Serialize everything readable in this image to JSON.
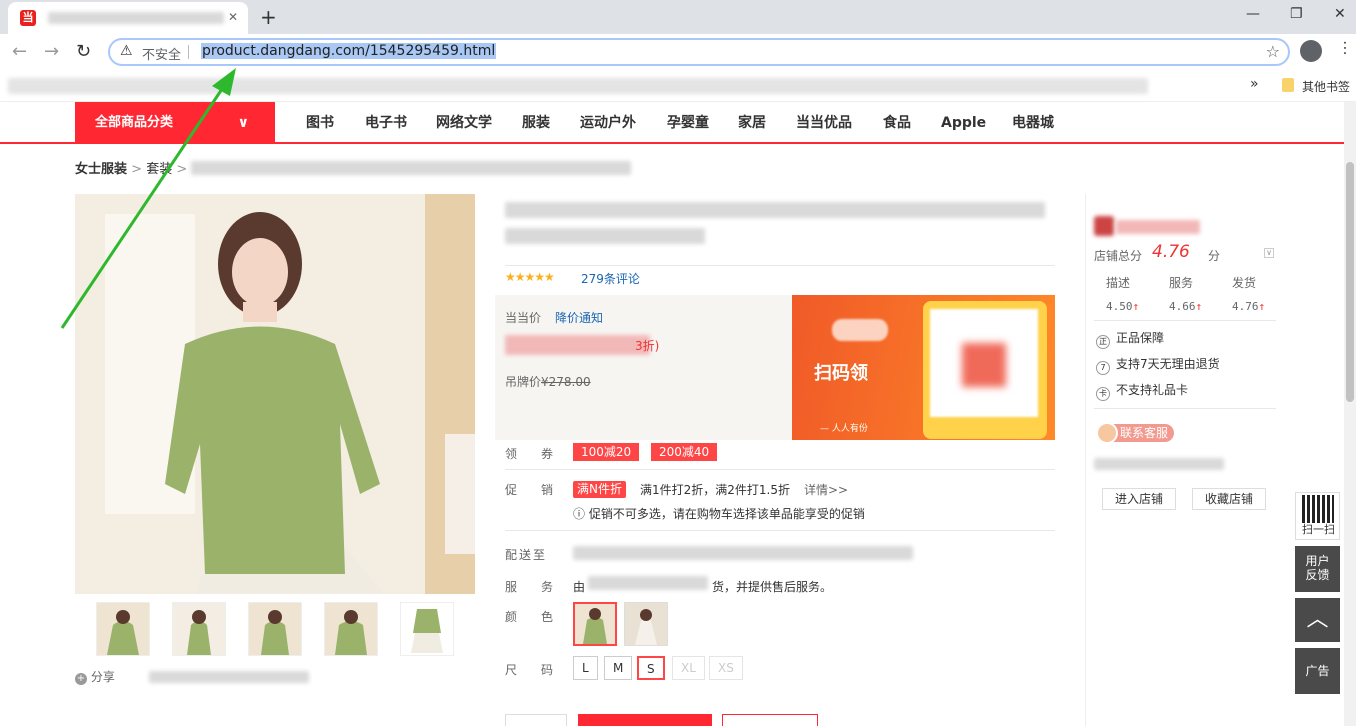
{
  "browser": {
    "address_security": "不安全",
    "url": "product.dangdang.com/1545295459.html",
    "bookmarks_other": "其他书签",
    "more_bookmarks": "»"
  },
  "nav": {
    "all_categories": "全部商品分类",
    "items": [
      "图书",
      "电子书",
      "网络文学",
      "服装",
      "运动户外",
      "孕婴童",
      "家居",
      "当当优品",
      "食品",
      "Apple",
      "电器城"
    ]
  },
  "breadcrumb": {
    "level1": "女士服装",
    "sep": ">",
    "level2": "套装",
    "sep2": ">"
  },
  "product": {
    "review_stars": "★★★★★",
    "review_count": "279条评论",
    "price_label": "当当价",
    "price_notify": "降价通知",
    "discount_fragment": "3折)",
    "list_price_label": "吊牌价",
    "list_price": "¥278.00",
    "scan_text": "扫码领",
    "scan_sub": "— 人人有份",
    "coupon_label": "领　券",
    "coupons": [
      "100减20",
      "200减40"
    ],
    "promo_label": "促　销",
    "promo_tag": "满N件折",
    "promo_text": "满1件打2折，满2件打1.5折",
    "promo_detail": "详情>>",
    "promo_warn": "ⓘ 促销不可多选，请在购物车选择该单品能享受的促销",
    "ship_label": "配送至",
    "service_label": "服　务",
    "service_pre": "由",
    "service_post": "货，并提供售后服务。",
    "color_label": "颜　色",
    "size_label": "尺　码",
    "sizes": [
      "L",
      "M",
      "S",
      "XL",
      "XS"
    ],
    "share": "分享"
  },
  "store": {
    "score_label": "店铺总分",
    "score": "4.76",
    "score_unit": "分",
    "sub_labels": [
      "描述",
      "服务",
      "发货"
    ],
    "sub_values": [
      "4.50",
      "4.66",
      "4.76"
    ],
    "up_mark": "↑",
    "guarantees": [
      "正品保障",
      "支持7天无理由退货",
      "不支持礼品卡"
    ],
    "guarantee_icons": [
      "正",
      "7",
      "卡"
    ],
    "contact": "联系客服",
    "enter": "进入店铺",
    "favorite": "收藏店铺"
  },
  "side_tools": {
    "scan": "扫一扫",
    "feedback_1": "用户",
    "feedback_2": "反馈",
    "to_top": "︿",
    "ad": "广告"
  }
}
